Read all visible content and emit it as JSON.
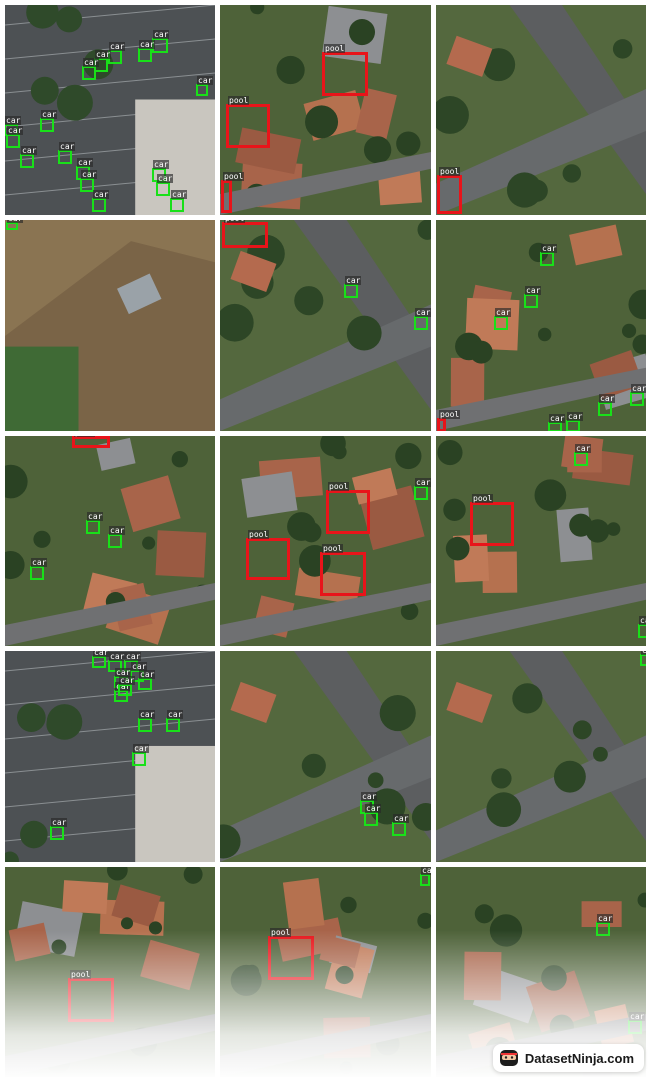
{
  "labels": {
    "car": "car",
    "pool": "pool"
  },
  "colors": {
    "car": "#19e019",
    "pool": "#e8141a"
  },
  "brand": {
    "name": "DatasetNinja.com",
    "icon": "ninja-logo-icon"
  },
  "tiles": [
    {
      "scene": "parking",
      "objects": [
        {
          "cls": "car",
          "r": [
            152,
            38,
            168,
            53
          ]
        },
        {
          "cls": "car",
          "r": [
            138,
            48,
            152,
            62
          ]
        },
        {
          "cls": "car",
          "r": [
            108,
            50,
            122,
            64
          ]
        },
        {
          "cls": "car",
          "r": [
            94,
            58,
            108,
            72
          ]
        },
        {
          "cls": "car",
          "r": [
            82,
            66,
            96,
            80
          ]
        },
        {
          "cls": "car",
          "r": [
            196,
            84,
            208,
            96
          ]
        },
        {
          "cls": "car",
          "r": [
            40,
            118,
            54,
            132
          ]
        },
        {
          "cls": "car",
          "r": [
            4,
            124,
            18,
            136
          ]
        },
        {
          "cls": "car",
          "r": [
            6,
            134,
            20,
            148
          ]
        },
        {
          "cls": "car",
          "r": [
            20,
            154,
            34,
            168
          ]
        },
        {
          "cls": "car",
          "r": [
            58,
            150,
            72,
            164
          ]
        },
        {
          "cls": "car",
          "r": [
            76,
            166,
            90,
            180
          ]
        },
        {
          "cls": "car",
          "r": [
            80,
            178,
            94,
            192
          ]
        },
        {
          "cls": "car",
          "r": [
            152,
            168,
            166,
            182
          ]
        },
        {
          "cls": "car",
          "r": [
            156,
            182,
            170,
            196
          ]
        },
        {
          "cls": "car",
          "r": [
            92,
            198,
            106,
            212
          ]
        },
        {
          "cls": "car",
          "r": [
            170,
            198,
            184,
            212
          ]
        }
      ]
    },
    {
      "scene": "houses",
      "objects": [
        {
          "cls": "pool",
          "r": [
            322,
            52,
            368,
            96
          ]
        },
        {
          "cls": "pool",
          "r": [
            226,
            104,
            270,
            148
          ]
        },
        {
          "cls": "pool",
          "r": [
            221,
            180,
            232,
            213
          ]
        }
      ]
    },
    {
      "scene": "street",
      "objects": [
        {
          "cls": "pool",
          "r": [
            437,
            175,
            462,
            214
          ]
        }
      ]
    },
    {
      "scene": "field",
      "objects": [
        {
          "cls": "car",
          "r": [
            6,
            222,
            18,
            230
          ]
        }
      ]
    },
    {
      "scene": "street",
      "objects": [
        {
          "cls": "pool",
          "r": [
            222,
            222,
            268,
            248
          ]
        },
        {
          "cls": "car",
          "r": [
            344,
            284,
            358,
            298
          ]
        },
        {
          "cls": "car",
          "r": [
            414,
            316,
            428,
            330
          ]
        }
      ]
    },
    {
      "scene": "houses",
      "objects": [
        {
          "cls": "car",
          "r": [
            540,
            252,
            554,
            266
          ]
        },
        {
          "cls": "car",
          "r": [
            524,
            294,
            538,
            308
          ]
        },
        {
          "cls": "car",
          "r": [
            494,
            316,
            508,
            330
          ]
        },
        {
          "cls": "car",
          "r": [
            598,
            402,
            612,
            416
          ]
        },
        {
          "cls": "car",
          "r": [
            630,
            392,
            644,
            406
          ]
        },
        {
          "cls": "car",
          "r": [
            548,
            422,
            562,
            432
          ]
        },
        {
          "cls": "car",
          "r": [
            566,
            420,
            580,
            432
          ]
        },
        {
          "cls": "pool",
          "r": [
            437,
            418,
            446,
            432
          ]
        }
      ]
    },
    {
      "scene": "houses",
      "objects": [
        {
          "cls": "pool",
          "r": [
            72,
            436,
            110,
            448
          ]
        },
        {
          "cls": "car",
          "r": [
            86,
            520,
            100,
            534
          ]
        },
        {
          "cls": "car",
          "r": [
            108,
            534,
            122,
            548
          ]
        },
        {
          "cls": "car",
          "r": [
            30,
            566,
            44,
            580
          ]
        }
      ]
    },
    {
      "scene": "houses",
      "objects": [
        {
          "cls": "pool",
          "r": [
            326,
            490,
            370,
            534
          ]
        },
        {
          "cls": "pool",
          "r": [
            246,
            538,
            290,
            580
          ]
        },
        {
          "cls": "pool",
          "r": [
            320,
            552,
            366,
            596
          ]
        },
        {
          "cls": "car",
          "r": [
            414,
            486,
            428,
            500
          ]
        }
      ]
    },
    {
      "scene": "houses",
      "objects": [
        {
          "cls": "pool",
          "r": [
            470,
            502,
            514,
            546
          ]
        },
        {
          "cls": "car",
          "r": [
            574,
            452,
            588,
            466
          ]
        },
        {
          "cls": "car",
          "r": [
            638,
            624,
            648,
            638
          ]
        }
      ]
    },
    {
      "scene": "parking",
      "objects": [
        {
          "cls": "car",
          "r": [
            92,
            656,
            106,
            668
          ]
        },
        {
          "cls": "car",
          "r": [
            108,
            660,
            122,
            672
          ]
        },
        {
          "cls": "car",
          "r": [
            124,
            660,
            138,
            672
          ]
        },
        {
          "cls": "car",
          "r": [
            130,
            670,
            144,
            682
          ]
        },
        {
          "cls": "car",
          "r": [
            114,
            676,
            128,
            688
          ]
        },
        {
          "cls": "car",
          "r": [
            138,
            678,
            152,
            690
          ]
        },
        {
          "cls": "car",
          "r": [
            114,
            690,
            128,
            702
          ]
        },
        {
          "cls": "car",
          "r": [
            118,
            684,
            132,
            696
          ]
        },
        {
          "cls": "car",
          "r": [
            138,
            718,
            152,
            732
          ]
        },
        {
          "cls": "car",
          "r": [
            166,
            718,
            180,
            732
          ]
        },
        {
          "cls": "car",
          "r": [
            132,
            752,
            146,
            766
          ]
        },
        {
          "cls": "car",
          "r": [
            50,
            826,
            64,
            840
          ]
        }
      ]
    },
    {
      "scene": "street",
      "objects": [
        {
          "cls": "car",
          "r": [
            360,
            800,
            374,
            814
          ]
        },
        {
          "cls": "car",
          "r": [
            364,
            812,
            378,
            826
          ]
        },
        {
          "cls": "car",
          "r": [
            392,
            822,
            406,
            836
          ]
        }
      ]
    },
    {
      "scene": "street",
      "objects": [
        {
          "cls": "car",
          "r": [
            640,
            654,
            648,
            666
          ]
        }
      ]
    },
    {
      "scene": "houses",
      "objects": [
        {
          "cls": "pool",
          "r": [
            68,
            978,
            114,
            1022
          ]
        }
      ]
    },
    {
      "scene": "houses",
      "objects": [
        {
          "cls": "pool",
          "r": [
            268,
            936,
            314,
            980
          ]
        },
        {
          "cls": "car",
          "r": [
            420,
            874,
            430,
            886
          ]
        }
      ]
    },
    {
      "scene": "houses",
      "objects": [
        {
          "cls": "car",
          "r": [
            596,
            922,
            610,
            936
          ]
        },
        {
          "cls": "car",
          "r": [
            628,
            1020,
            642,
            1034
          ]
        }
      ]
    }
  ]
}
